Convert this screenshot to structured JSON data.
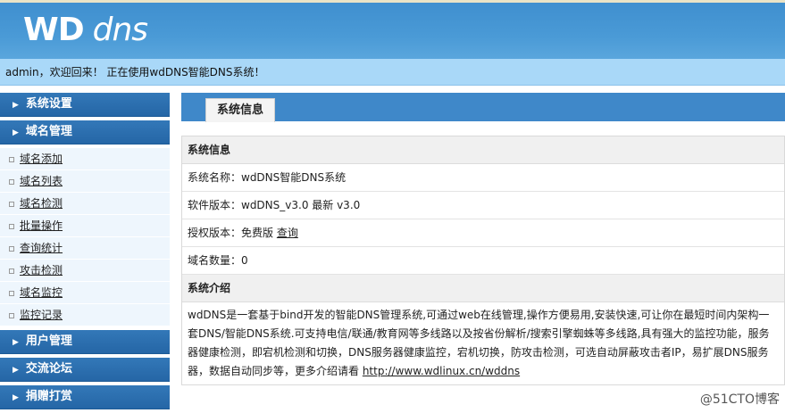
{
  "header": {
    "logo_main": "WD",
    "logo_dns": "dns"
  },
  "welcome": "admin，欢迎回来！  正在使用wdDNS智能DNS系统！",
  "sidebar": {
    "sections": [
      {
        "label": "系统设置"
      },
      {
        "label": "域名管理"
      },
      {
        "label": "用户管理"
      },
      {
        "label": "交流论坛"
      },
      {
        "label": "捐赠打赏"
      }
    ],
    "domain_items": [
      "域名添加",
      "域名列表",
      "域名检测",
      "批量操作",
      "查询统计",
      "攻击检测",
      "域名监控",
      "监控记录"
    ]
  },
  "tab": {
    "label": "系统信息"
  },
  "info": {
    "section_title": "系统信息",
    "system_name": "系统名称：wdDNS智能DNS系统",
    "software_version": "软件版本：wdDNS_v3.0 最新 v3.0",
    "license_label": "授权版本：免费版",
    "license_link": "查询",
    "domain_count": "域名数量：0"
  },
  "intro": {
    "section_title": "系统介绍",
    "text": "wdDNS是一套基于bind开发的智能DNS管理系统,可通过web在线管理,操作方便易用,安装快速,可让你在最短时间内架构一套DNS/智能DNS系统.可支持电信/联通/教育网等多线路以及按省份解析/搜索引擎蜘蛛等多线路,具有强大的监控功能，服务器健康检测，即宕机检测和切换，DNS服务器健康监控，宕机切换，防攻击检测，可选自动屏蔽攻击者IP，易扩展DNS服务器，数据自动同步等，更多介绍请看 ",
    "link": "http://www.wdlinux.cn/wddns"
  },
  "watermark": "@51CTO博客"
}
